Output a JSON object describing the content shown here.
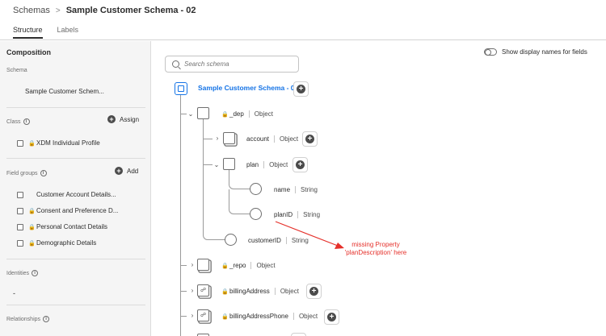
{
  "breadcrumb": {
    "parent": "Schemas",
    "separator": ">",
    "current": "Sample Customer Schema - 02"
  },
  "tabs": [
    "Structure",
    "Labels"
  ],
  "composition": {
    "title": "Composition",
    "schema_label": "Schema",
    "schema_name": "Sample Customer Schem...",
    "class_label": "Class",
    "assign_label": "Assign",
    "class_item": "XDM Individual Profile",
    "fieldgroups_label": "Field groups",
    "add_label": "Add",
    "field_groups": [
      "Customer Account Details...",
      "Consent and Preference D...",
      "Personal Contact Details",
      "Demographic Details"
    ],
    "identities_label": "Identities",
    "identities_value": "-",
    "relationships_label": "Relationships"
  },
  "search": {
    "placeholder": "Search schema"
  },
  "toggle_label": "Show display names for fields",
  "tree": {
    "root": "Sample Customer Schema - 02",
    "nodes": [
      {
        "name": "_dep",
        "type": "Object"
      },
      {
        "name": "account",
        "type": "Object"
      },
      {
        "name": "plan",
        "type": "Object"
      },
      {
        "name": "name",
        "type": "String"
      },
      {
        "name": "planID",
        "type": "String"
      },
      {
        "name": "customerID",
        "type": "String"
      },
      {
        "name": "_repo",
        "type": "Object"
      },
      {
        "name": "billingAddress",
        "type": "Object"
      },
      {
        "name": "billingAddressPhone",
        "type": "Object"
      }
    ]
  },
  "annotation": {
    "line1": "missing Property",
    "line2": "'planDescription' here"
  },
  "colors": {
    "accent": "#1473e6",
    "annotation": "#e5302a"
  }
}
